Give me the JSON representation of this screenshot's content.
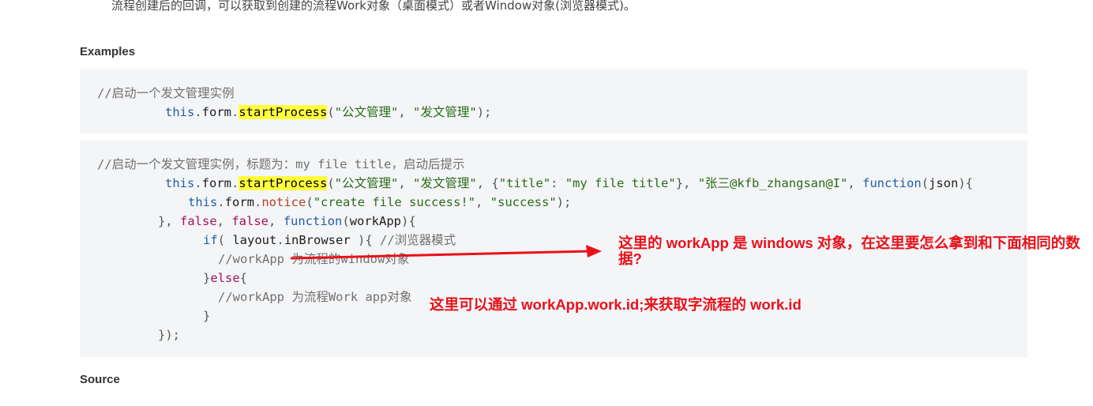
{
  "intro_text": "流程创建后的回调，可以获取到创建的流程Work对象（桌面模式）或者Window对象(浏览器模式)。",
  "examples_heading": "Examples",
  "source_heading": "Source",
  "example1": {
    "comment": "//启动一个发文管理实例",
    "l2_this": "this",
    "l2_dot1": ".",
    "l2_form": "form",
    "l2_dot2": ".",
    "l2_fn": "startProcess",
    "l2_open": "(",
    "l2_arg1": "\"公文管理\"",
    "l2_comma": ", ",
    "l2_arg2": "\"发文管理\"",
    "l2_close": ");"
  },
  "example2": {
    "comment": "//启动一个发文管理实例，标题为：my file title，启动后提示",
    "l2_this": "this",
    "l2_form": "form",
    "l2_fn": "startProcess",
    "l2_arg1": "\"公文管理\"",
    "l2_arg2": "\"发文管理\"",
    "l2_obj_open": "{",
    "l2_key": "\"title\"",
    "l2_colon": ": ",
    "l2_val": "\"my file title\"",
    "l2_obj_close": "}",
    "l2_arg4": "\"张三@kfb_zhangsan@I\"",
    "l2_function": "function",
    "l2_param": "json",
    "l2_end": "){",
    "l3_this": "this",
    "l3_form": "form",
    "l3_notice": "notice",
    "l3_arg1": "\"create file success!\"",
    "l3_arg2": "\"success\"",
    "l3_close": ");",
    "l4_close": "}, ",
    "l4_false1": "false",
    "l4_false2": "false",
    "l4_function": "function",
    "l4_param": "workApp",
    "l4_end": "){",
    "l5_if": "if",
    "l5_open": "( ",
    "l5_layout": "layout",
    "l5_prop": "inBrowser",
    "l5_close": " ){ ",
    "l5_comment": "//浏览器模式",
    "l6_comment": "//workApp 为流程的window对象",
    "l7_close": "}",
    "l7_else": "else",
    "l7_open": "{",
    "l8_comment": "//workApp 为流程Work app对象",
    "l9_close": "}",
    "l10_close": "});"
  },
  "annotations": {
    "arrow_note": "这里的 workApp 是 windows 对象，在这里要怎么拿到和下面相同的数据?",
    "work_note": "这里可以通过 workApp.work.id;来获取字流程的 work.id"
  },
  "colors": {
    "annotation": "#e8111a",
    "highlight": "#ffff3d",
    "code_bg": "#f4f5f7"
  }
}
